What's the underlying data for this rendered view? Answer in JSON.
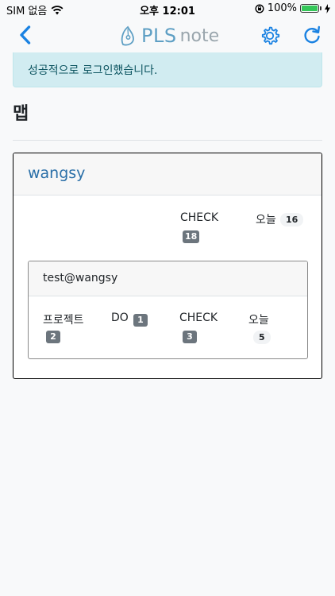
{
  "status_bar": {
    "carrier": "SIM 없음",
    "time": "오후 12:01",
    "battery": "100%"
  },
  "nav": {
    "logo_text": "PLS",
    "logo_sub": "note"
  },
  "alert": {
    "message": "성공적으로 로그인했습니다."
  },
  "page": {
    "title": "맵"
  },
  "user_card": {
    "name": "wangsy",
    "stats": {
      "check_label": "CHECK",
      "check_count": "18",
      "today_label": "오늘",
      "today_count": "16"
    },
    "project_card": {
      "name": "test@wangsy",
      "project_label": "프로젝트",
      "project_count": "2",
      "do_label": "DO",
      "do_count": "1",
      "check_label": "CHECK",
      "check_count": "3",
      "today_label": "오늘",
      "today_count": "5"
    }
  },
  "colors": {
    "accent": "#1a82e2",
    "alert_bg": "#d1ecf1",
    "alert_text": "#0c5460",
    "card_title": "#2a6fa8",
    "badge_dark": "#6c757d",
    "battery_green": "#34c759"
  },
  "icons": {
    "back": "chevron-left-icon",
    "settings": "gear-icon",
    "refresh": "refresh-icon",
    "logo": "pen-nib-icon"
  }
}
